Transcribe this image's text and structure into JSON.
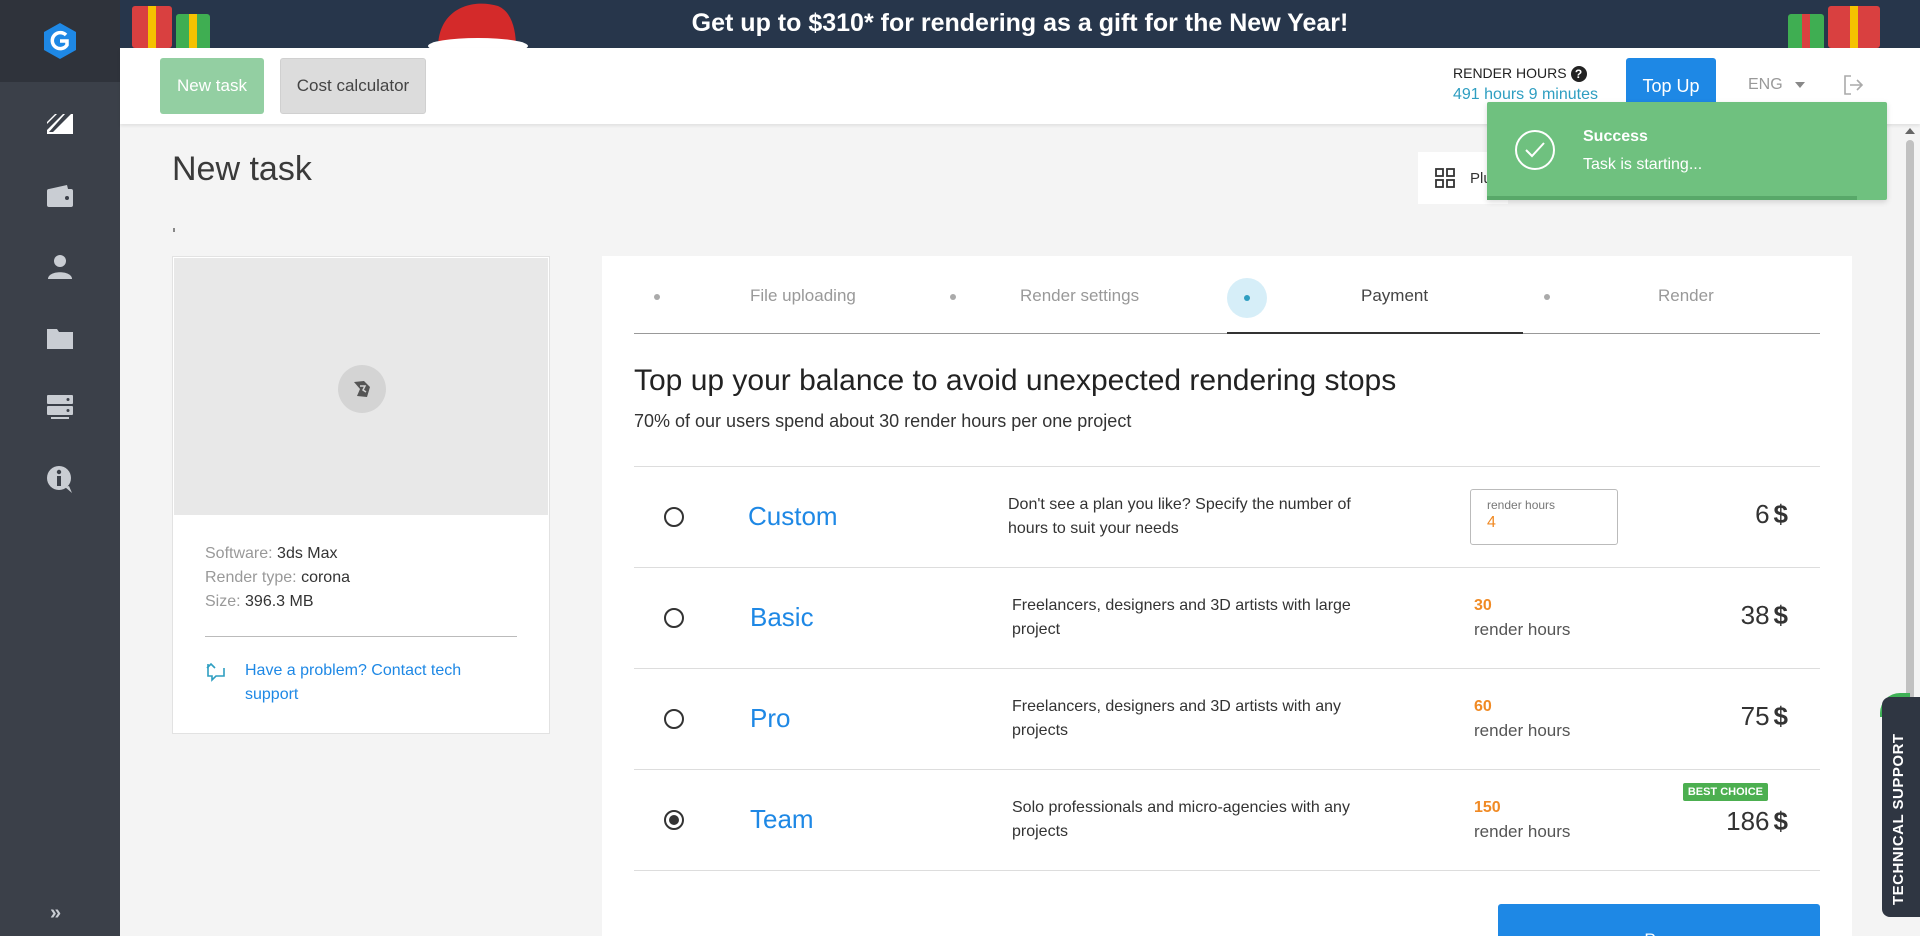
{
  "banner": {
    "text": "Get up to $310* for rendering as a gift for the New Year!"
  },
  "sidebar": {
    "items": [
      {
        "icon": "render-tasks-icon"
      },
      {
        "icon": "wallet-icon"
      },
      {
        "icon": "user-icon"
      },
      {
        "icon": "folder-icon"
      },
      {
        "icon": "server-icon"
      },
      {
        "icon": "info-icon"
      }
    ],
    "expand_label": "»"
  },
  "header": {
    "new_task_label": "New task",
    "cost_calculator_label": "Cost calculator",
    "render_hours_label": "RENDER HOURS",
    "render_hours_help": "?",
    "render_hours_value": "491 hours 9 minutes",
    "top_up_label": "Top Up",
    "language": "ENG"
  },
  "page": {
    "title": "New task",
    "plugins_label": "Plu"
  },
  "file": {
    "software_label": "Software:",
    "software_value": "3ds Max",
    "render_type_label": "Render type:",
    "render_type_value": "corona",
    "size_label": "Size:",
    "size_value": "396.3 MB",
    "support_text": "Have a problem? Contact tech support"
  },
  "steps": [
    {
      "label": "File uploading",
      "active": false
    },
    {
      "label": "Render settings",
      "active": false
    },
    {
      "label": "Payment",
      "active": true
    },
    {
      "label": "Render",
      "active": false
    }
  ],
  "payment": {
    "headline": "Top up your balance to avoid unexpected rendering stops",
    "subline": "70% of our users spend about 30 render hours per one project",
    "plans": [
      {
        "name": "Custom",
        "description": "Don't see a plan you like? Specify the number of hours to suit your needs",
        "hours_field_label": "render hours",
        "hours_field_value": "4",
        "price": "6",
        "currency": "$",
        "selected": false
      },
      {
        "name": "Basic",
        "description": "Freelancers, designers and 3D artists with large project",
        "hours": "30",
        "hours_unit": "render hours",
        "price": "38",
        "currency": "$",
        "selected": false
      },
      {
        "name": "Pro",
        "description": "Freelancers, designers and 3D artists with any projects",
        "hours": "60",
        "hours_unit": "render hours",
        "price": "75",
        "currency": "$",
        "selected": false
      },
      {
        "name": "Team",
        "description": "Solo professionals and micro-agencies with any projects",
        "hours": "150",
        "hours_unit": "render hours",
        "price": "186",
        "currency": "$",
        "badge": "BEST CHOICE",
        "selected": true
      }
    ],
    "pay_label": "Pay"
  },
  "toast": {
    "title": "Success",
    "message": "Task is starting..."
  },
  "tech_support": {
    "label": "TECHNICAL SUPPORT"
  },
  "colors": {
    "accent_blue": "#1e88e5",
    "sidebar_bg": "#3b4049",
    "success_green": "#6fc17f",
    "hours_orange": "#f08a24"
  }
}
